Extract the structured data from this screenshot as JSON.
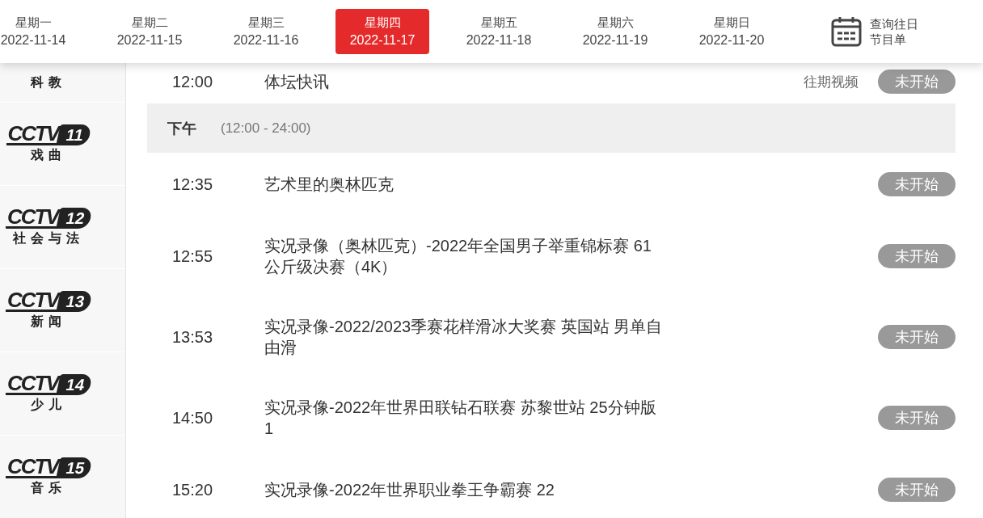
{
  "days": [
    {
      "weekday": "星期一",
      "date": "2022-11-14",
      "selected": false
    },
    {
      "weekday": "星期二",
      "date": "2022-11-15",
      "selected": false
    },
    {
      "weekday": "星期三",
      "date": "2022-11-16",
      "selected": false
    },
    {
      "weekday": "星期四",
      "date": "2022-11-17",
      "selected": true
    },
    {
      "weekday": "星期五",
      "date": "2022-11-18",
      "selected": false
    },
    {
      "weekday": "星期六",
      "date": "2022-11-19",
      "selected": false
    },
    {
      "weekday": "星期日",
      "date": "2022-11-20",
      "selected": false
    }
  ],
  "history_link": "查询往日节目单",
  "channels": [
    {
      "name": "科教"
    },
    {
      "wordmark": "CCTV",
      "number": "11",
      "name": "戏曲"
    },
    {
      "wordmark": "CCTV",
      "number": "12",
      "name": "社会与法"
    },
    {
      "wordmark": "CCTV",
      "number": "13",
      "name": "新闻"
    },
    {
      "wordmark": "CCTV",
      "number": "14",
      "name": "少儿"
    },
    {
      "wordmark": "CCTV",
      "number": "15",
      "name": "音乐"
    }
  ],
  "schedule": [
    {
      "kind": "program",
      "time": "12:00",
      "title": "体坛快讯",
      "replay": "往期视频",
      "status": "未开始"
    },
    {
      "kind": "period",
      "label": "下午",
      "range": "(12:00 - 24:00)"
    },
    {
      "kind": "program",
      "time": "12:35",
      "title": "艺术里的奥林匹克",
      "status": "未开始"
    },
    {
      "kind": "program",
      "time": "12:55",
      "title": "实况录像（奥林匹克）-2022年全国男子举重锦标赛 61公斤级决赛（4K）",
      "status": "未开始"
    },
    {
      "kind": "program",
      "time": "13:53",
      "title": "实况录像-2022/2023季赛花样滑冰大奖赛 英国站 男单自由滑",
      "status": "未开始"
    },
    {
      "kind": "program",
      "time": "14:50",
      "title": "实况录像-2022年世界田联钻石联赛 苏黎世站 25分钟版 1",
      "status": "未开始"
    },
    {
      "kind": "program",
      "time": "15:20",
      "title": "实况录像-2022年世界职业拳王争霸赛 22",
      "status": "未开始"
    }
  ]
}
